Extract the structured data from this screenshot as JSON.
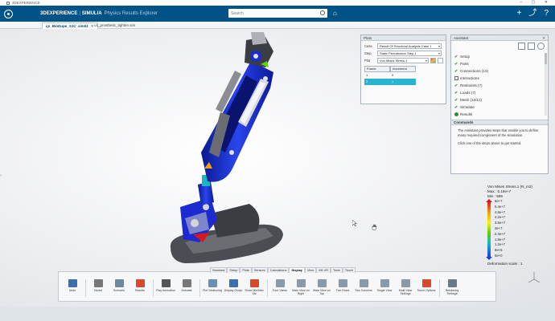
{
  "window": {
    "title": "3DEXPERIENCE",
    "controls": "–  ▢  ✕"
  },
  "header": {
    "brand": "3DEXPERIENCE",
    "separator": "|",
    "app": "SIMULIA",
    "app_subtitle": "Physics Results Explorer",
    "search_placeholder": "Search",
    "add_symbol": "+",
    "share_symbol": "⤴",
    "help_symbol": "?"
  },
  "tabs": [
    {
      "label": "cp_BioDupe_S1C_sim01",
      "active": true
    },
    {
      "label": "o1_prosthetic_tighten.sim",
      "active": false
    }
  ],
  "plots": {
    "title": "Plots",
    "case_label": "Case",
    "case_value": "Result Of Structural Analysis Case.1",
    "step_label": "Step",
    "step_value": "Static Perturbation Step.1",
    "plot_label": "Plot",
    "plot_value": "Von Mises Stress.1",
    "table_headers": [
      "Frame",
      "Increment"
    ],
    "table_rows": [
      [
        "1",
        "0"
      ],
      [
        "2",
        "1"
      ]
    ]
  },
  "assistant": {
    "title": "Assistant",
    "close": "✕",
    "steps": [
      {
        "label": "Setup",
        "state": "done"
      },
      {
        "label": "Parts",
        "state": "done"
      },
      {
        "label": "Connections (13)",
        "state": "done"
      },
      {
        "label": "Interactions",
        "state": "empty"
      },
      {
        "label": "Restraints (7)",
        "state": "done"
      },
      {
        "label": "Loads (7)",
        "state": "done"
      },
      {
        "label": "Mesh (12/12)",
        "state": "done"
      },
      {
        "label": "Simulate",
        "state": "done"
      },
      {
        "label": "Results",
        "state": "active"
      }
    ],
    "commands_title": "Commands",
    "commands_text": "The Assistant provides steps that enable you to define many required component of the simulation.",
    "commands_text2": "Click one of the steps above to get started."
  },
  "legend": {
    "title": "Von Mises Stress.1 (N_m2)",
    "max": "Max : 6.19e+7",
    "min": "Min : 599",
    "ticks": [
      "6e+7",
      "5.4e+7",
      "4.8e+7",
      "4.2e+7",
      "3.6e+7",
      "3e+7",
      "2.4e+7",
      "1.8e+7",
      "1.2e+7",
      "6e+6",
      "0e+0"
    ],
    "deformation": "Deformation scale : 1"
  },
  "actionbar": {
    "tabs": [
      "Standard",
      "Setup",
      "Plots",
      "Sensors",
      "Calculations",
      "Display",
      "View",
      "AR-VR",
      "Tools",
      "Touch"
    ],
    "active_tab": "Display",
    "tools": [
      {
        "name": "undo",
        "label": "Undo",
        "color": "#3a6fb0"
      },
      {
        "name": "model",
        "label": "Model",
        "color": "#777777"
      },
      {
        "name": "scenario",
        "label": "Scenario",
        "color": "#6f8a9f"
      },
      {
        "name": "results",
        "label": "Results",
        "color": "#d9482a"
      },
      {
        "name": "play-animation",
        "label": "Play Animation",
        "color": "#555555"
      },
      {
        "name": "animate",
        "label": "Animate",
        "color": "#777777"
      },
      {
        "name": "plot-sectioning",
        "label": "Plot Sectioning",
        "color": "#6a8fb4"
      },
      {
        "name": "display-group",
        "label": "Display Group",
        "color": "#3a6fb0"
      },
      {
        "name": "show-min-max",
        "label": "Show Min/Max Val",
        "color": "#d9482a"
      },
      {
        "name": "four-views",
        "label": "Four Views",
        "color": "#8a9aa8"
      },
      {
        "name": "main-view-right",
        "label": "Main View on Right",
        "color": "#8a9aa8"
      },
      {
        "name": "main-view-top",
        "label": "Main View on Top",
        "color": "#8a9aa8"
      },
      {
        "name": "two-rows",
        "label": "Two Rows",
        "color": "#8a9aa8"
      },
      {
        "name": "two-columns",
        "label": "Two Columns",
        "color": "#8a9aa8"
      },
      {
        "name": "single-view",
        "label": "Single View",
        "color": "#8a9aa8"
      },
      {
        "name": "multi-view-settings",
        "label": "Multi-View Settings",
        "color": "#8a9aa8"
      },
      {
        "name": "touch-options",
        "label": "Touch Options",
        "color": "#d9482a"
      },
      {
        "name": "rendering-settings",
        "label": "Rendering Settings",
        "color": "#6a7a88"
      }
    ]
  },
  "colors": {
    "header_bg": "#005386",
    "highlight": "#27b3d1",
    "model_blue": "#1a2fd6"
  }
}
